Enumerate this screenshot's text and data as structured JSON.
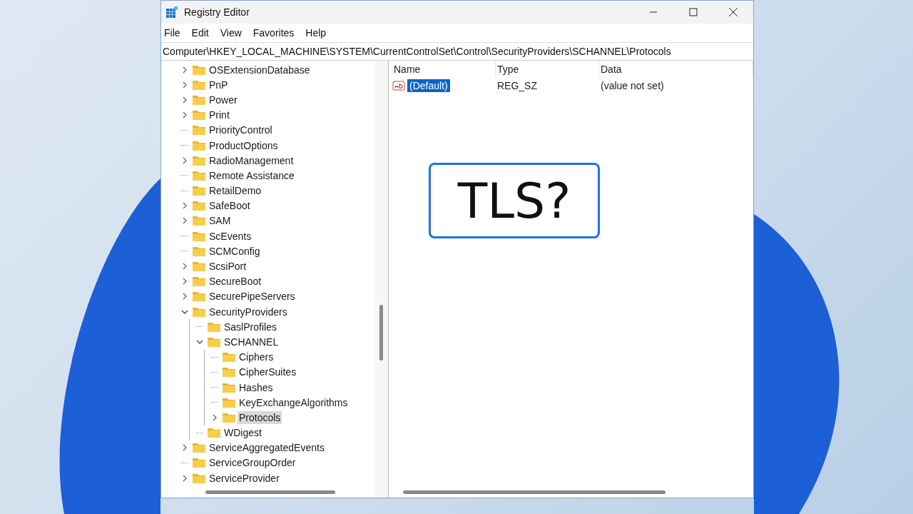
{
  "window": {
    "title": "Registry Editor"
  },
  "menu": [
    "File",
    "Edit",
    "View",
    "Favorites",
    "Help"
  ],
  "address": "Computer\\HKEY_LOCAL_MACHINE\\SYSTEM\\CurrentControlSet\\Control\\SecurityProviders\\SCHANNEL\\Protocols",
  "tree": [
    {
      "label": "OSExtensionDatabase",
      "kind": "collapsed",
      "selected": false
    },
    {
      "label": "PnP",
      "kind": "collapsed",
      "selected": false
    },
    {
      "label": "Power",
      "kind": "collapsed",
      "selected": false
    },
    {
      "label": "Print",
      "kind": "collapsed",
      "selected": false
    },
    {
      "label": "PriorityControl",
      "kind": "leaf",
      "selected": false
    },
    {
      "label": "ProductOptions",
      "kind": "leaf",
      "selected": false
    },
    {
      "label": "RadioManagement",
      "kind": "collapsed",
      "selected": false
    },
    {
      "label": "Remote Assistance",
      "kind": "leaf",
      "selected": false
    },
    {
      "label": "RetailDemo",
      "kind": "leaf",
      "selected": false
    },
    {
      "label": "SafeBoot",
      "kind": "collapsed",
      "selected": false
    },
    {
      "label": "SAM",
      "kind": "collapsed",
      "selected": false
    },
    {
      "label": "ScEvents",
      "kind": "leaf",
      "selected": false
    },
    {
      "label": "SCMConfig",
      "kind": "leaf",
      "selected": false
    },
    {
      "label": "ScsiPort",
      "kind": "collapsed",
      "selected": false
    },
    {
      "label": "SecureBoot",
      "kind": "collapsed",
      "selected": false
    },
    {
      "label": "SecurePipeServers",
      "kind": "collapsed",
      "selected": false
    },
    {
      "label": "SecurityProviders",
      "kind": "expanded",
      "selected": false,
      "children": [
        {
          "label": "SaslProfiles",
          "kind": "leaf",
          "selected": false
        },
        {
          "label": "SCHANNEL",
          "kind": "expanded",
          "selected": false,
          "children": [
            {
              "label": "Ciphers",
              "kind": "leaf",
              "selected": false
            },
            {
              "label": "CipherSuites",
              "kind": "leaf",
              "selected": false
            },
            {
              "label": "Hashes",
              "kind": "leaf",
              "selected": false
            },
            {
              "label": "KeyExchangeAlgorithms",
              "kind": "leaf",
              "selected": false
            },
            {
              "label": "Protocols",
              "kind": "collapsed",
              "selected": true
            }
          ]
        },
        {
          "label": "WDigest",
          "kind": "leaf",
          "selected": false
        }
      ]
    },
    {
      "label": "ServiceAggregatedEvents",
      "kind": "collapsed",
      "selected": false
    },
    {
      "label": "ServiceGroupOrder",
      "kind": "leaf",
      "selected": false
    },
    {
      "label": "ServiceProvider",
      "kind": "collapsed",
      "selected": false
    }
  ],
  "table": {
    "columns": [
      "Name",
      "Type",
      "Data"
    ],
    "rows": [
      {
        "name": "(Default)",
        "type": "REG_SZ",
        "data": "(value not set)",
        "selected": true
      }
    ]
  },
  "callout": {
    "text": "TLS?"
  }
}
